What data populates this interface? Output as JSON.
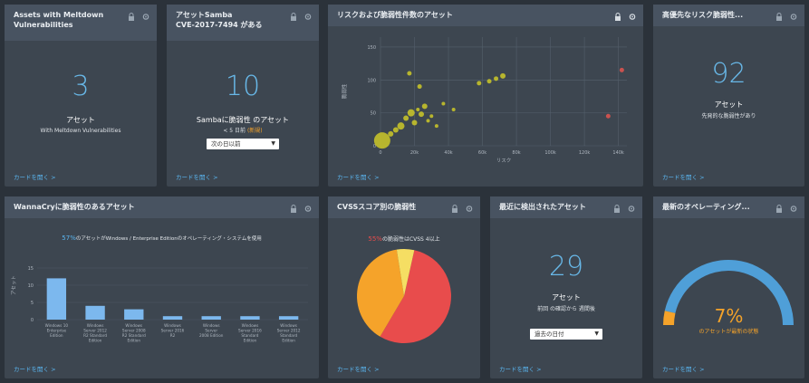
{
  "cards": {
    "c1": {
      "title": "Assets with Meltdown Vulnerabilities",
      "value": "3",
      "label": "アセット",
      "sublabel": "With Meltdown Vulnerabilities",
      "link": "カードを開く >"
    },
    "c2": {
      "title_line1": "アセットSamba",
      "title_line2": "CVE-2017-7494 がある",
      "value": "10",
      "label": "Sambaに脆弱性 のアセット",
      "sublabel": "< 5 日前 ",
      "sublabel_highlight": "(新規)",
      "select": "次の日以前",
      "link": "カードを開く >"
    },
    "c3": {
      "title": "リスクおよび脆弱性件数のアセット",
      "xlabel": "リスク",
      "ylabel": "脆弱性",
      "link": "カードを開く >"
    },
    "c4": {
      "title": "高優先なリスク脆弱性...",
      "value": "92",
      "label": "アセット",
      "sublabel": "先発的な脆弱性があり",
      "link": "カードを開く >"
    },
    "c5": {
      "title": "WannaCryに脆弱性のあるアセット",
      "summary_pct": "57%",
      "summary_text": "のアセットがWindows / Enterprise Editionのオペレーティング・システムを使用",
      "ylabel": "アセット",
      "link": "カードを開く >"
    },
    "c6": {
      "title": "CVSSスコア別の脆弱性",
      "summary_pct": "55%",
      "summary_text": "の脆弱性はCVSS 4以上",
      "link": "カードを開く >"
    },
    "c7": {
      "title": "最近に検出されたアセット",
      "value": "29",
      "label": "アセット",
      "sublabel": "前回 の確認から 週間後",
      "select": "過去の日付",
      "link": "カードを開く >"
    },
    "c8": {
      "title": "最新のオペレーティング...",
      "gauge_label": "7%",
      "gauge_sub": "のアセットが最新の状態",
      "gauge_fraction": 0.07,
      "link": "カードを開く >"
    }
  },
  "colors": {
    "accent_blue": "#5ab5ef",
    "big_number": "#68b8e8",
    "scatter_yellow": "#c4c12a",
    "scatter_red": "#d9534f",
    "bar_blue": "#7cb8ee",
    "pie_red": "#e84c4c",
    "pie_orange": "#f5a32a",
    "pie_yellow": "#f5de63",
    "gauge_blue": "#4f9fd8",
    "gauge_orange": "#f5a32a"
  },
  "icons": [
    "lock-icon",
    "gear-icon",
    "chevron-down-icon",
    "link-arrow-icon"
  ],
  "chart_data": [
    {
      "type": "scatter",
      "title": "リスクおよび脆弱性件数のアセット",
      "xlabel": "リスク",
      "ylabel": "脆弱性",
      "x_ticks": [
        "0",
        "20k",
        "40k",
        "60k",
        "80k",
        "100k",
        "120k",
        "140k"
      ],
      "y_ticks": [
        "0",
        "50",
        "100",
        "150"
      ],
      "xlim": [
        0,
        145000
      ],
      "ylim": [
        0,
        165
      ],
      "series": [
        {
          "color": "#c4c12a",
          "points": [
            [
              1000,
              8,
              9
            ],
            [
              6000,
              18,
              3
            ],
            [
              9000,
              24,
              3
            ],
            [
              12000,
              30,
              4
            ],
            [
              15000,
              42,
              3
            ],
            [
              18000,
              50,
              4
            ],
            [
              20000,
              35,
              3
            ],
            [
              22000,
              55,
              2
            ],
            [
              24000,
              48,
              3
            ],
            [
              26000,
              60,
              3
            ],
            [
              28000,
              38,
              2
            ],
            [
              30000,
              45,
              2
            ],
            [
              33000,
              30,
              2
            ],
            [
              37000,
              64,
              2
            ],
            [
              43000,
              55,
              2
            ],
            [
              17000,
              110,
              2.5
            ],
            [
              23000,
              90,
              2.5
            ],
            [
              58000,
              95,
              2.5
            ],
            [
              64000,
              98,
              2.5
            ],
            [
              68000,
              102,
              2.5
            ],
            [
              72000,
              106,
              3
            ]
          ]
        },
        {
          "color": "#d9534f",
          "points": [
            [
              142000,
              115,
              2.5
            ],
            [
              134000,
              45,
              2.5
            ]
          ]
        }
      ]
    },
    {
      "type": "bar",
      "title": "WannaCryに脆弱性のあるアセット",
      "ylabel": "アセット",
      "y_ticks": [
        "0",
        "5",
        "10",
        "15"
      ],
      "ylim": [
        0,
        20
      ],
      "categories": [
        [
          "Windows 10",
          "Enterprise",
          "Edition"
        ],
        [
          "Windows",
          "Server 2012",
          "R2 Standard",
          "Edition"
        ],
        [
          "Windows",
          "Server 2008",
          "R2 Standard",
          "Edition"
        ],
        [
          "Windows",
          "Server 2016",
          "R2"
        ],
        [
          "Windows",
          "Server",
          "2008 Edition"
        ],
        [
          "Windows",
          "Server 2016",
          "Standard",
          "Edition"
        ],
        [
          "Windows",
          "Server 2012",
          "Standard",
          "Edition"
        ]
      ],
      "values": [
        12,
        4,
        3,
        1,
        1,
        1,
        1
      ]
    },
    {
      "type": "pie",
      "title": "CVSSスコア別の脆弱性",
      "slices": [
        {
          "value": 55,
          "color": "#e84c4c"
        },
        {
          "value": 39,
          "color": "#f5a32a"
        },
        {
          "value": 6,
          "color": "#f5de63"
        }
      ]
    }
  ]
}
